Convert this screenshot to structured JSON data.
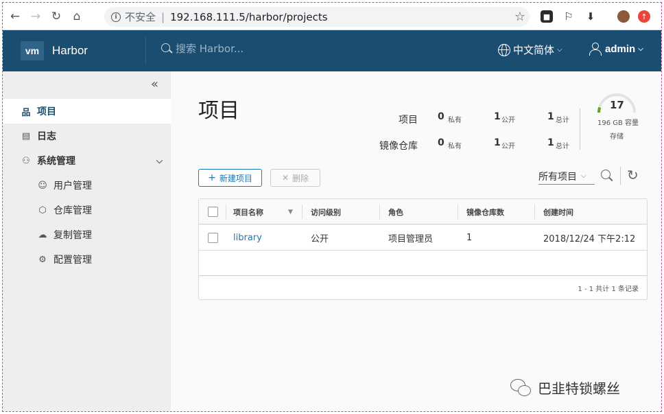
{
  "browser": {
    "insecure_label": "不安全",
    "separator": "|",
    "url": "192.168.111.5/harbor/projects"
  },
  "header": {
    "logo": "vm",
    "app_title": "Harbor",
    "search_placeholder": "搜索 Harbor...",
    "language": "中文简体",
    "user": "admin"
  },
  "sidebar": {
    "items": [
      {
        "label": "项目",
        "icon": "projects-icon"
      },
      {
        "label": "日志",
        "icon": "logs-icon"
      },
      {
        "label": "系统管理",
        "icon": "admin-icon"
      },
      {
        "label": "用户管理",
        "icon": "users-icon"
      },
      {
        "label": "仓库管理",
        "icon": "registry-icon"
      },
      {
        "label": "复制管理",
        "icon": "replication-icon"
      },
      {
        "label": "配置管理",
        "icon": "config-icon"
      }
    ]
  },
  "main": {
    "title": "项目",
    "stats": {
      "projects_label": "项目",
      "repos_label": "镜像仓库",
      "project_private": "0",
      "project_public": "1",
      "project_total": "1",
      "repo_private": "0",
      "repo_public": "1",
      "repo_total": "1",
      "private_label": "私有",
      "public_label": "公开",
      "total_label": "总计"
    },
    "storage": {
      "percent": "17",
      "capacity": "196 GB 容量",
      "label": "存储"
    },
    "toolbar": {
      "new_project": "新建项目",
      "delete": "删除",
      "filter": "所有项目"
    },
    "table": {
      "columns": [
        "项目名称",
        "访问级别",
        "角色",
        "镜像仓库数",
        "创建时间"
      ],
      "rows": [
        {
          "name": "library",
          "access": "公开",
          "role": "项目管理员",
          "repo_count": "1",
          "created": "2018/12/24 下午2:12"
        }
      ],
      "footer": "1 - 1 共计 1 条记录"
    }
  },
  "watermark": "巴韭特锁螺丝",
  "colors": {
    "header_bg": "#1b4d70",
    "link": "#1b79b4",
    "sidebar_bg": "#eeeeee"
  }
}
